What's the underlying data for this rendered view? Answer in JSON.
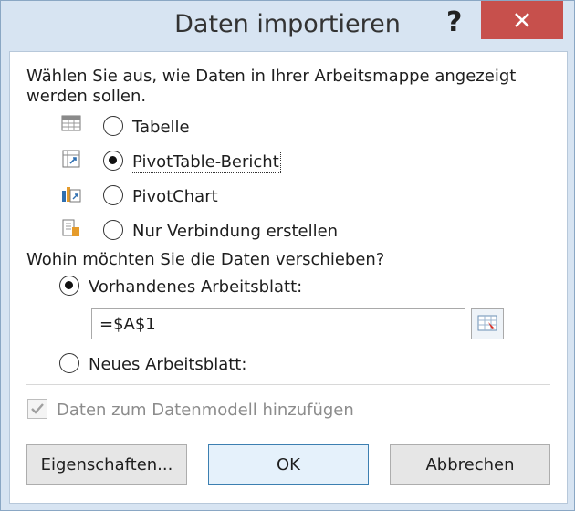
{
  "window": {
    "title": "Daten importieren"
  },
  "intro": "Wählen Sie aus, wie Daten in Ihrer Arbeitsmappe angezeigt werden sollen.",
  "view_options": [
    {
      "label": "Tabelle",
      "selected": false,
      "icon": "table-icon"
    },
    {
      "label": "PivotTable-Bericht",
      "selected": true,
      "icon": "pivottable-icon"
    },
    {
      "label": "PivotChart",
      "selected": false,
      "icon": "pivotchart-icon"
    },
    {
      "label": "Nur Verbindung erstellen",
      "selected": false,
      "icon": "connection-only-icon"
    }
  ],
  "destination": {
    "question": "Wohin möchten Sie die Daten verschieben?",
    "existing_label": "Vorhandenes Arbeitsblatt:",
    "existing_selected": true,
    "range_value": "=$A$1",
    "new_label": "Neues Arbeitsblatt:",
    "new_selected": false
  },
  "data_model": {
    "label": "Daten zum Datenmodell hinzufügen",
    "checked": true,
    "disabled": true
  },
  "buttons": {
    "properties": "Eigenschaften...",
    "ok": "OK",
    "cancel": "Abbrechen"
  },
  "colors": {
    "frame": "#d7e4f2",
    "close": "#c7504c",
    "default_button": "#3c7fb1"
  }
}
